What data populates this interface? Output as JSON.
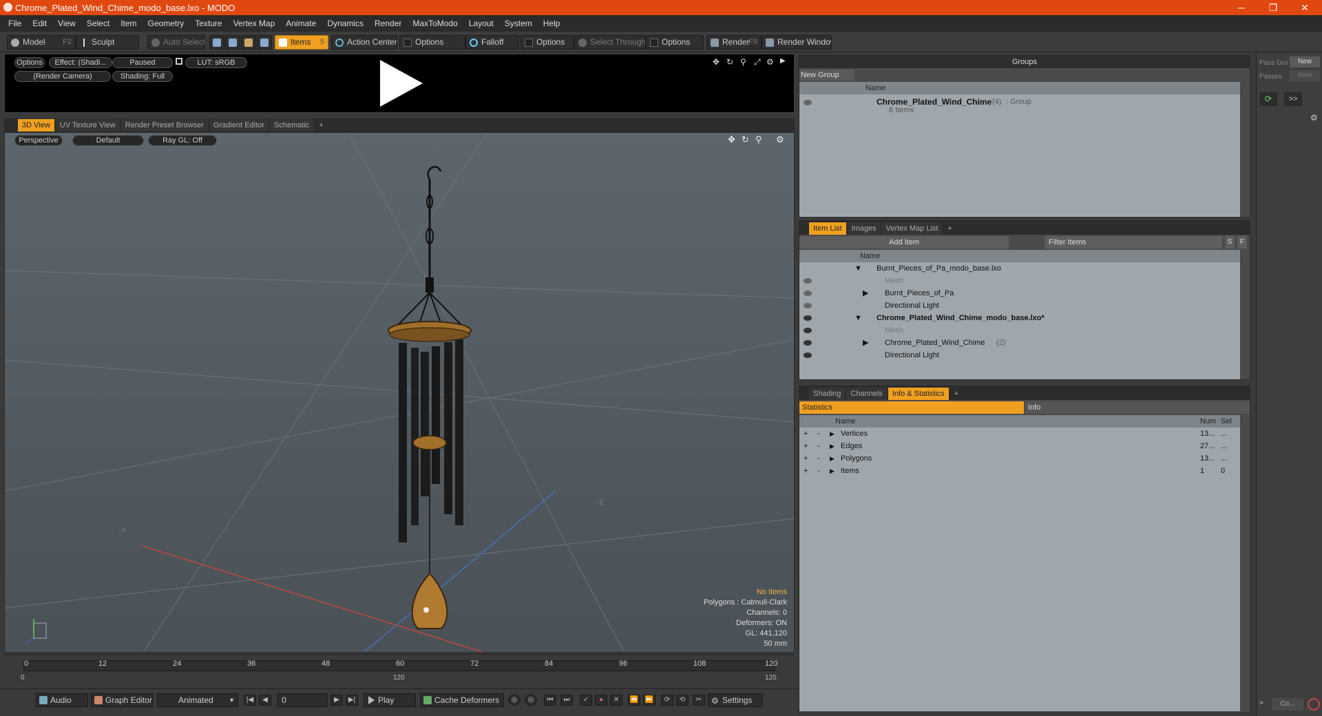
{
  "window": {
    "title": "Chrome_Plated_Wind_Chime_modo_base.lxo - MODO",
    "minimize": "─",
    "maximize": "❐",
    "close": "✕"
  },
  "menu": [
    "File",
    "Edit",
    "View",
    "Select",
    "Item",
    "Geometry",
    "Texture",
    "Vertex Map",
    "Animate",
    "Dynamics",
    "Render",
    "MaxToModo",
    "Layout",
    "System",
    "Help"
  ],
  "toolbar": {
    "model": "Model",
    "model_key": "F2",
    "sculpt": "Sculpt",
    "auto_select": "Auto Select",
    "items": "Items",
    "items_key": "5",
    "action_center": "Action Center",
    "options1": "Options",
    "falloff": "Falloff",
    "options2": "Options",
    "select_through": "Select Through",
    "options3": "Options",
    "render": "Render",
    "render_key": "F9",
    "render_window": "Render Window"
  },
  "viewer": {
    "options": "Options",
    "effect": "Effect: (Shadi...",
    "paused": "Paused",
    "lut": "LUT: sRGB",
    "camera": "(Render Camera)",
    "shading": "Shading: Full"
  },
  "viewport_tabs": [
    "3D View",
    "UV Texture View",
    "Render Preset Browser",
    "Gradient Editor",
    "Schematic",
    "+"
  ],
  "viewport": {
    "perspective": "Perspective",
    "default": "Default",
    "raygl": "Ray GL: Off",
    "axis_x": "-X",
    "axis_z": "-Z",
    "no_items": "No Items",
    "polygons": "Polygons : Catmull-Clark",
    "channels": "Channels: 0",
    "deformers": "Deformers: ON",
    "gl": "GL: 441,120",
    "lens": "50 mm"
  },
  "timeline": {
    "ticks": [
      "0",
      "12",
      "24",
      "36",
      "48",
      "60",
      "72",
      "84",
      "96",
      "108",
      "120"
    ],
    "start": "0",
    "mid": "120",
    "end": "120"
  },
  "bottom": {
    "audio": "Audio",
    "graph_editor": "Graph Editor",
    "animated": "Animated",
    "frame": "0",
    "play": "Play",
    "cache_deformers": "Cache Deformers",
    "settings": "Settings"
  },
  "groups": {
    "title": "Groups",
    "new_group": "New Group",
    "col_name": "Name",
    "group_name": "Chrome_Plated_Wind_Chime",
    "group_count": "(4)",
    "group_type": ": Group",
    "group_items": "8 Items"
  },
  "itemlist": {
    "tabs": [
      "Item List",
      "Images",
      "Vertex Map List",
      "+"
    ],
    "add_item": "Add Item",
    "filter": "Filter Items",
    "s": "S",
    "f": "F",
    "col_name": "Name",
    "rows": [
      {
        "label": "Burnt_Pieces_of_Pa_modo_base.lxo",
        "bold": false
      },
      {
        "label": "Mesh",
        "dim": true
      },
      {
        "label": "Burnt_Pieces_of_Pa"
      },
      {
        "label": "Directional Light"
      },
      {
        "label": "Chrome_Plated_Wind_Chime_modo_base.lxo*",
        "bold": true
      },
      {
        "label": "Mesh",
        "dim": true
      },
      {
        "label": "Chrome_Plated_Wind_Chime",
        "count": "(2)"
      },
      {
        "label": "Directional Light"
      }
    ]
  },
  "stats": {
    "tabs": [
      "Shading",
      "Channels",
      "Info & Statistics",
      "+"
    ],
    "statistics": "Statistics",
    "info": "Info",
    "col_name": "Name",
    "col_num": "Num",
    "col_sel": "Sel",
    "rows": [
      {
        "name": "Vertices",
        "num": "13...",
        "sel": "..."
      },
      {
        "name": "Edges",
        "num": "27...",
        "sel": "..."
      },
      {
        "name": "Polygons",
        "num": "13...",
        "sel": "..."
      },
      {
        "name": "Items",
        "num": "1",
        "sel": "0"
      }
    ]
  },
  "right": {
    "pass_group": "Pass Gro",
    "passes": "Passes",
    "new1": "New",
    "new2": "New",
    "more": ">>",
    "co": "Co..."
  }
}
